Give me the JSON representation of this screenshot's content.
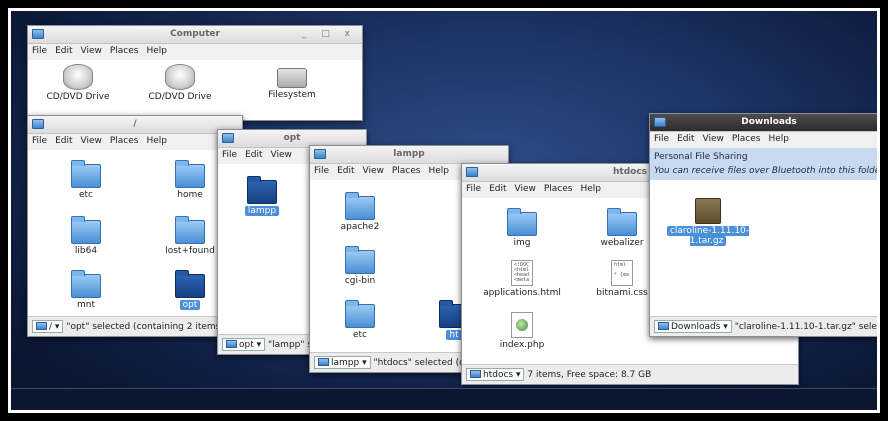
{
  "menu": [
    "File",
    "Edit",
    "View",
    "Places",
    "Help"
  ],
  "computer": {
    "title": "Computer",
    "items": [
      "CD/DVD Drive",
      "CD/DVD Drive",
      "Filesystem"
    ]
  },
  "root": {
    "title": "/",
    "items": [
      "etc",
      "home",
      "lib64",
      "lost+found",
      "mnt",
      "opt"
    ],
    "status_path": "/",
    "status_text": "\"opt\" selected (containing 2 items)"
  },
  "opt": {
    "title": "opt",
    "items": [
      "lampp"
    ],
    "status_path": "opt",
    "status_text": "\"lampp\" s"
  },
  "lampp": {
    "title": "lampp",
    "items": [
      "apache2",
      "cgi-bin",
      "etc",
      "ht"
    ],
    "status_path": "lampp",
    "status_text": "\"htdocs\" selected (co"
  },
  "htdocs": {
    "title": "htdocs",
    "items": [
      "img",
      "webalizer",
      "applications.html",
      "bitnami.css",
      "index.php"
    ],
    "status_path": "htdocs",
    "status_text": "7 items, Free space: 8.7 GB"
  },
  "downloads": {
    "title": "Downloads",
    "sharing_title": "Personal File Sharing",
    "sharing_sub": "You can receive files over Bluetooth into this folder",
    "item": "claroline-1.11.10-1.tar.gz",
    "status_path": "Downloads",
    "status_text": "\"claroline-1.11.10-1.tar.gz\" selected"
  },
  "window_controls": "_ □ x",
  "colors": {
    "desktop": "#1d3466",
    "selection": "#4a90d9",
    "folder": "#4a8fd4"
  }
}
